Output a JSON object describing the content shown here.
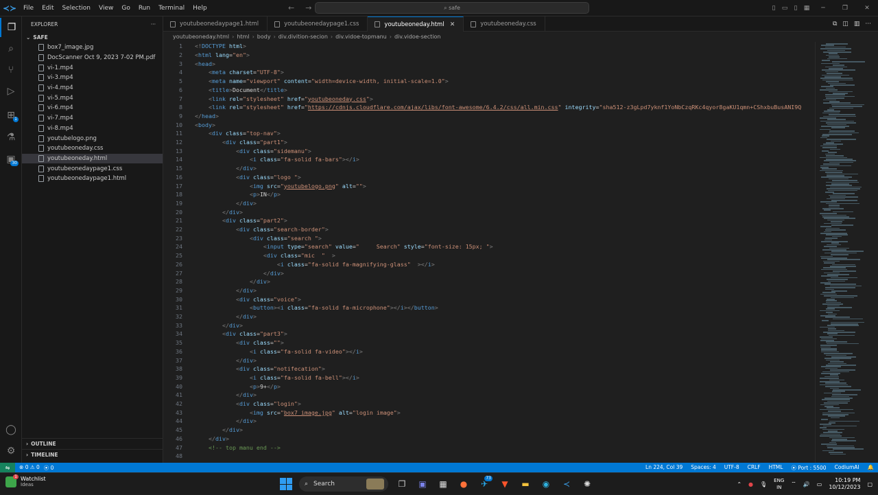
{
  "titlebar": {
    "menu": [
      "File",
      "Edit",
      "Selection",
      "View",
      "Go",
      "Run",
      "Terminal",
      "Help"
    ],
    "search_text": "safe"
  },
  "activity": {
    "extensions_badge": "1",
    "accounts_badge": "30"
  },
  "explorer": {
    "title": "EXPLORER",
    "folder": "SAFE",
    "files": [
      "box7_image.jpg",
      "DocScanner Oct 9, 2023 7-02 PM.pdf",
      "vi-1.mp4",
      "vi-3.mp4",
      "vi-4.mp4",
      "vi-5.mp4",
      "vi-6.mp4",
      "vi-7.mp4",
      "vi-8.mp4",
      "youtubelogo.png",
      "youtubeoneday.css",
      "youtubeoneday.html",
      "youtubeonedaypage1.css",
      "youtubeonedaypage1.html"
    ],
    "outline": "OUTLINE",
    "timeline": "TIMELINE"
  },
  "tabs": [
    {
      "label": "youtubeonedaypage1.html"
    },
    {
      "label": "youtubeonedaypage1.css"
    },
    {
      "label": "youtubeoneday.html"
    },
    {
      "label": "youtubeoneday.css"
    }
  ],
  "breadcrumb": [
    "youtubeoneday.html",
    "html",
    "body",
    "div.divition-secion",
    "div.vidoe-topmanu",
    "div.vidoe-section"
  ],
  "code_lines": [
    [
      [
        "t-punc",
        "<!"
      ],
      [
        "t-tag",
        "DOCTYPE "
      ],
      [
        "t-attr",
        "html"
      ],
      [
        "t-punc",
        ">"
      ]
    ],
    [
      [
        "t-punc",
        "<"
      ],
      [
        "t-tag",
        "html "
      ],
      [
        "t-attr",
        "lang"
      ],
      [
        "t-text",
        "="
      ],
      [
        "t-str",
        "\"en\""
      ],
      [
        "t-punc",
        ">"
      ]
    ],
    [
      [
        "t-punc",
        "<"
      ],
      [
        "t-tag",
        "head"
      ],
      [
        "t-punc",
        ">"
      ]
    ],
    [
      [
        "t-text",
        "    "
      ],
      [
        "t-punc",
        "<"
      ],
      [
        "t-tag",
        "meta "
      ],
      [
        "t-attr",
        "charset"
      ],
      [
        "t-text",
        "="
      ],
      [
        "t-str",
        "\"UTF-8\""
      ],
      [
        "t-punc",
        ">"
      ]
    ],
    [
      [
        "t-text",
        "    "
      ],
      [
        "t-punc",
        "<"
      ],
      [
        "t-tag",
        "meta "
      ],
      [
        "t-attr",
        "name"
      ],
      [
        "t-text",
        "="
      ],
      [
        "t-str",
        "\"viewport\" "
      ],
      [
        "t-attr",
        "content"
      ],
      [
        "t-text",
        "="
      ],
      [
        "t-str",
        "\"width=device-width, initial-scale=1.0\""
      ],
      [
        "t-punc",
        ">"
      ]
    ],
    [
      [
        "t-text",
        "    "
      ],
      [
        "t-punc",
        "<"
      ],
      [
        "t-tag",
        "title"
      ],
      [
        "t-punc",
        ">"
      ],
      [
        "t-text",
        "Document"
      ],
      [
        "t-punc",
        "</"
      ],
      [
        "t-tag",
        "title"
      ],
      [
        "t-punc",
        ">"
      ]
    ],
    [
      [
        "t-text",
        "    "
      ],
      [
        "t-punc",
        "<"
      ],
      [
        "t-tag",
        "link "
      ],
      [
        "t-attr",
        "rel"
      ],
      [
        "t-text",
        "="
      ],
      [
        "t-str",
        "\"stylesheet\" "
      ],
      [
        "t-attr",
        "href"
      ],
      [
        "t-text",
        "="
      ],
      [
        "t-str",
        "\""
      ],
      [
        "t-link",
        "youtubeoneday.css"
      ],
      [
        "t-str",
        "\""
      ],
      [
        "t-punc",
        ">"
      ]
    ],
    [
      [
        "t-text",
        "    "
      ],
      [
        "t-punc",
        "<"
      ],
      [
        "t-tag",
        "link "
      ],
      [
        "t-attr",
        "rel"
      ],
      [
        "t-text",
        "="
      ],
      [
        "t-str",
        "\"stylesheet\" "
      ],
      [
        "t-attr",
        "href"
      ],
      [
        "t-text",
        "="
      ],
      [
        "t-str",
        "\""
      ],
      [
        "t-link",
        "https://cdnjs.cloudflare.com/ajax/libs/font-awesome/6.4.2/css/all.min.css"
      ],
      [
        "t-str",
        "\" "
      ],
      [
        "t-attr",
        "integrity"
      ],
      [
        "t-text",
        "="
      ],
      [
        "t-str",
        "\"sha512-z3gLpd7yknf1YoNbCzqRKc4qyor8gaKU1qmn+CShxbuBusANI9Q"
      ]
    ],
    [
      [
        "t-punc",
        "</"
      ],
      [
        "t-tag",
        "head"
      ],
      [
        "t-punc",
        ">"
      ]
    ],
    [
      [
        "t-punc",
        "<"
      ],
      [
        "t-tag",
        "body"
      ],
      [
        "t-punc",
        ">"
      ]
    ],
    [
      [
        "t-text",
        "    "
      ],
      [
        "t-punc",
        "<"
      ],
      [
        "t-tag",
        "div "
      ],
      [
        "t-attr",
        "class"
      ],
      [
        "t-text",
        "="
      ],
      [
        "t-str",
        "\"top-nav\""
      ],
      [
        "t-punc",
        ">"
      ]
    ],
    [
      [
        "t-text",
        "        "
      ],
      [
        "t-punc",
        "<"
      ],
      [
        "t-tag",
        "div "
      ],
      [
        "t-attr",
        "class"
      ],
      [
        "t-text",
        "="
      ],
      [
        "t-str",
        "\"part1\""
      ],
      [
        "t-punc",
        ">"
      ]
    ],
    [
      [
        "t-text",
        "            "
      ],
      [
        "t-punc",
        "<"
      ],
      [
        "t-tag",
        "div "
      ],
      [
        "t-attr",
        "class"
      ],
      [
        "t-text",
        "="
      ],
      [
        "t-str",
        "\"sidemanu\""
      ],
      [
        "t-punc",
        ">"
      ]
    ],
    [
      [
        "t-text",
        "                "
      ],
      [
        "t-punc",
        "<"
      ],
      [
        "t-tag",
        "i "
      ],
      [
        "t-attr",
        "class"
      ],
      [
        "t-text",
        "="
      ],
      [
        "t-str",
        "\"fa-solid fa-bars\""
      ],
      [
        "t-punc",
        "></"
      ],
      [
        "t-tag",
        "i"
      ],
      [
        "t-punc",
        ">"
      ]
    ],
    [
      [
        "t-text",
        "            "
      ],
      [
        "t-punc",
        "</"
      ],
      [
        "t-tag",
        "div"
      ],
      [
        "t-punc",
        ">"
      ]
    ],
    [
      [
        "t-text",
        "            "
      ],
      [
        "t-punc",
        "<"
      ],
      [
        "t-tag",
        "div "
      ],
      [
        "t-attr",
        "class"
      ],
      [
        "t-text",
        "="
      ],
      [
        "t-str",
        "\"logo \""
      ],
      [
        "t-punc",
        ">"
      ]
    ],
    [
      [
        "t-text",
        "                "
      ],
      [
        "t-punc",
        "<"
      ],
      [
        "t-tag",
        "img "
      ],
      [
        "t-attr",
        "src"
      ],
      [
        "t-text",
        "="
      ],
      [
        "t-str",
        "\""
      ],
      [
        "t-link",
        "youtubelogo.png"
      ],
      [
        "t-str",
        "\" "
      ],
      [
        "t-attr",
        "alt"
      ],
      [
        "t-text",
        "="
      ],
      [
        "t-str",
        "\"\""
      ],
      [
        "t-punc",
        ">"
      ]
    ],
    [
      [
        "t-text",
        "                "
      ],
      [
        "t-punc",
        "<"
      ],
      [
        "t-tag",
        "p"
      ],
      [
        "t-punc",
        ">"
      ],
      [
        "t-text",
        "IN"
      ],
      [
        "t-punc",
        "</"
      ],
      [
        "t-tag",
        "p"
      ],
      [
        "t-punc",
        ">"
      ]
    ],
    [
      [
        "t-text",
        "            "
      ],
      [
        "t-punc",
        "</"
      ],
      [
        "t-tag",
        "div"
      ],
      [
        "t-punc",
        ">"
      ]
    ],
    [
      [
        "t-text",
        "        "
      ],
      [
        "t-punc",
        "</"
      ],
      [
        "t-tag",
        "div"
      ],
      [
        "t-punc",
        ">"
      ]
    ],
    [
      [
        "t-text",
        "        "
      ],
      [
        "t-punc",
        "<"
      ],
      [
        "t-tag",
        "div "
      ],
      [
        "t-attr",
        "class"
      ],
      [
        "t-text",
        "="
      ],
      [
        "t-str",
        "\"part2\""
      ],
      [
        "t-punc",
        ">"
      ]
    ],
    [
      [
        "t-text",
        "            "
      ],
      [
        "t-punc",
        "<"
      ],
      [
        "t-tag",
        "div "
      ],
      [
        "t-attr",
        "class"
      ],
      [
        "t-text",
        "="
      ],
      [
        "t-str",
        "\"search-border\""
      ],
      [
        "t-punc",
        ">"
      ]
    ],
    [
      [
        "t-text",
        "                "
      ],
      [
        "t-punc",
        "<"
      ],
      [
        "t-tag",
        "div "
      ],
      [
        "t-attr",
        "class"
      ],
      [
        "t-text",
        "="
      ],
      [
        "t-str",
        "\"search \""
      ],
      [
        "t-punc",
        ">"
      ]
    ],
    [
      [
        "t-text",
        "                    "
      ],
      [
        "t-punc",
        "<"
      ],
      [
        "t-tag",
        "input "
      ],
      [
        "t-attr",
        "type"
      ],
      [
        "t-text",
        "="
      ],
      [
        "t-str",
        "\"search\" "
      ],
      [
        "t-attr",
        "value"
      ],
      [
        "t-text",
        "="
      ],
      [
        "t-str",
        "\"     Search\" "
      ],
      [
        "t-attr",
        "style"
      ],
      [
        "t-text",
        "="
      ],
      [
        "t-str",
        "\"font-size: 15px; \""
      ],
      [
        "t-punc",
        ">"
      ]
    ],
    [
      [
        "t-text",
        "                    "
      ],
      [
        "t-punc",
        "<"
      ],
      [
        "t-tag",
        "div "
      ],
      [
        "t-attr",
        "class"
      ],
      [
        "t-text",
        "="
      ],
      [
        "t-str",
        "\"mic  \"  "
      ],
      [
        "t-punc",
        ">"
      ]
    ],
    [
      [
        "t-text",
        "                        "
      ],
      [
        "t-punc",
        "<"
      ],
      [
        "t-tag",
        "i "
      ],
      [
        "t-attr",
        "class"
      ],
      [
        "t-text",
        "="
      ],
      [
        "t-str",
        "\"fa-solid fa-magnifying-glass\"  "
      ],
      [
        "t-punc",
        "></"
      ],
      [
        "t-tag",
        "i"
      ],
      [
        "t-punc",
        ">"
      ]
    ],
    [
      [
        "t-text",
        "                    "
      ],
      [
        "t-punc",
        "</"
      ],
      [
        "t-tag",
        "div"
      ],
      [
        "t-punc",
        ">"
      ]
    ],
    [
      [
        "t-text",
        "                "
      ],
      [
        "t-punc",
        "</"
      ],
      [
        "t-tag",
        "div"
      ],
      [
        "t-punc",
        ">"
      ]
    ],
    [
      [
        "t-text",
        "            "
      ],
      [
        "t-punc",
        "</"
      ],
      [
        "t-tag",
        "div"
      ],
      [
        "t-punc",
        ">"
      ]
    ],
    [
      [
        "t-text",
        "            "
      ],
      [
        "t-punc",
        "<"
      ],
      [
        "t-tag",
        "div "
      ],
      [
        "t-attr",
        "class"
      ],
      [
        "t-text",
        "="
      ],
      [
        "t-str",
        "\"voice\""
      ],
      [
        "t-punc",
        ">"
      ]
    ],
    [
      [
        "t-text",
        "                "
      ],
      [
        "t-punc",
        "<"
      ],
      [
        "t-tag",
        "button"
      ],
      [
        "t-punc",
        "><"
      ],
      [
        "t-tag",
        "i "
      ],
      [
        "t-attr",
        "class"
      ],
      [
        "t-text",
        "="
      ],
      [
        "t-str",
        "\"fa-solid fa-microphone\""
      ],
      [
        "t-punc",
        "></"
      ],
      [
        "t-tag",
        "i"
      ],
      [
        "t-punc",
        "></"
      ],
      [
        "t-tag",
        "button"
      ],
      [
        "t-punc",
        ">"
      ]
    ],
    [
      [
        "t-text",
        "            "
      ],
      [
        "t-punc",
        "</"
      ],
      [
        "t-tag",
        "div"
      ],
      [
        "t-punc",
        ">"
      ]
    ],
    [
      [
        "t-text",
        "        "
      ],
      [
        "t-punc",
        "</"
      ],
      [
        "t-tag",
        "div"
      ],
      [
        "t-punc",
        ">"
      ]
    ],
    [
      [
        "t-text",
        "        "
      ],
      [
        "t-punc",
        "<"
      ],
      [
        "t-tag",
        "div "
      ],
      [
        "t-attr",
        "class"
      ],
      [
        "t-text",
        "="
      ],
      [
        "t-str",
        "\"part3\""
      ],
      [
        "t-punc",
        ">"
      ]
    ],
    [
      [
        "t-text",
        "            "
      ],
      [
        "t-punc",
        "<"
      ],
      [
        "t-tag",
        "div "
      ],
      [
        "t-attr",
        "class"
      ],
      [
        "t-text",
        "="
      ],
      [
        "t-str",
        "\"\""
      ],
      [
        "t-punc",
        ">"
      ]
    ],
    [
      [
        "t-text",
        "                "
      ],
      [
        "t-punc",
        "<"
      ],
      [
        "t-tag",
        "i "
      ],
      [
        "t-attr",
        "class"
      ],
      [
        "t-text",
        "="
      ],
      [
        "t-str",
        "\"fa-solid fa-video\""
      ],
      [
        "t-punc",
        "></"
      ],
      [
        "t-tag",
        "i"
      ],
      [
        "t-punc",
        ">"
      ]
    ],
    [
      [
        "t-text",
        "            "
      ],
      [
        "t-punc",
        "</"
      ],
      [
        "t-tag",
        "div"
      ],
      [
        "t-punc",
        ">"
      ]
    ],
    [
      [
        "t-text",
        "            "
      ],
      [
        "t-punc",
        "<"
      ],
      [
        "t-tag",
        "div "
      ],
      [
        "t-attr",
        "class"
      ],
      [
        "t-text",
        "="
      ],
      [
        "t-str",
        "\"notifecation\""
      ],
      [
        "t-punc",
        ">"
      ]
    ],
    [
      [
        "t-text",
        "                "
      ],
      [
        "t-punc",
        "<"
      ],
      [
        "t-tag",
        "i "
      ],
      [
        "t-attr",
        "class"
      ],
      [
        "t-text",
        "="
      ],
      [
        "t-str",
        "\"fa-solid fa-bell\""
      ],
      [
        "t-punc",
        "></"
      ],
      [
        "t-tag",
        "i"
      ],
      [
        "t-punc",
        ">"
      ]
    ],
    [
      [
        "t-text",
        "                "
      ],
      [
        "t-punc",
        "<"
      ],
      [
        "t-tag",
        "p"
      ],
      [
        "t-punc",
        ">"
      ],
      [
        "t-text",
        "9+"
      ],
      [
        "t-punc",
        "</"
      ],
      [
        "t-tag",
        "p"
      ],
      [
        "t-punc",
        ">"
      ]
    ],
    [
      [
        "t-text",
        "            "
      ],
      [
        "t-punc",
        "</"
      ],
      [
        "t-tag",
        "div"
      ],
      [
        "t-punc",
        ">"
      ]
    ],
    [
      [
        "t-text",
        "            "
      ],
      [
        "t-punc",
        "<"
      ],
      [
        "t-tag",
        "div "
      ],
      [
        "t-attr",
        "class"
      ],
      [
        "t-text",
        "="
      ],
      [
        "t-str",
        "\"login\""
      ],
      [
        "t-punc",
        ">"
      ]
    ],
    [
      [
        "t-text",
        "                "
      ],
      [
        "t-punc",
        "<"
      ],
      [
        "t-tag",
        "img "
      ],
      [
        "t-attr",
        "src"
      ],
      [
        "t-text",
        "="
      ],
      [
        "t-str",
        "\""
      ],
      [
        "t-link",
        "box7_image.jpg"
      ],
      [
        "t-str",
        "\" "
      ],
      [
        "t-attr",
        "alt"
      ],
      [
        "t-text",
        "="
      ],
      [
        "t-str",
        "\"login image\""
      ],
      [
        "t-punc",
        ">"
      ]
    ],
    [
      [
        "t-text",
        "            "
      ],
      [
        "t-punc",
        "</"
      ],
      [
        "t-tag",
        "div"
      ],
      [
        "t-punc",
        ">"
      ]
    ],
    [
      [
        "t-text",
        "        "
      ],
      [
        "t-punc",
        "</"
      ],
      [
        "t-tag",
        "div"
      ],
      [
        "t-punc",
        ">"
      ]
    ],
    [
      [
        "t-text",
        "    "
      ],
      [
        "t-punc",
        "</"
      ],
      [
        "t-tag",
        "div"
      ],
      [
        "t-punc",
        ">"
      ]
    ],
    [
      [
        "t-text",
        "    "
      ],
      [
        "t-com",
        "<!-- top manu end -->"
      ]
    ],
    [
      [
        "t-text",
        ""
      ]
    ]
  ],
  "statusbar": {
    "errors": "0",
    "warnings": "0",
    "ports": "0",
    "cursor": "Ln 224, Col 39",
    "spaces": "Spaces: 4",
    "encoding": "UTF-8",
    "eol": "CRLF",
    "language": "HTML",
    "port": "Port : 5500",
    "ai": "CodiumAI"
  },
  "taskbar": {
    "weather_title": "Watchlist",
    "weather_sub": "Ideas",
    "weather_badge": "1",
    "search": "Search",
    "app_badge": "73",
    "lang_line1": "ENG",
    "lang_line2": "IN",
    "time": "10:19 PM",
    "date": "10/12/2023"
  },
  "colors": {
    "accent": "#0078d4",
    "editor_bg": "#1f1f1f",
    "sidebar_bg": "#181818",
    "remote": "#16825d"
  }
}
